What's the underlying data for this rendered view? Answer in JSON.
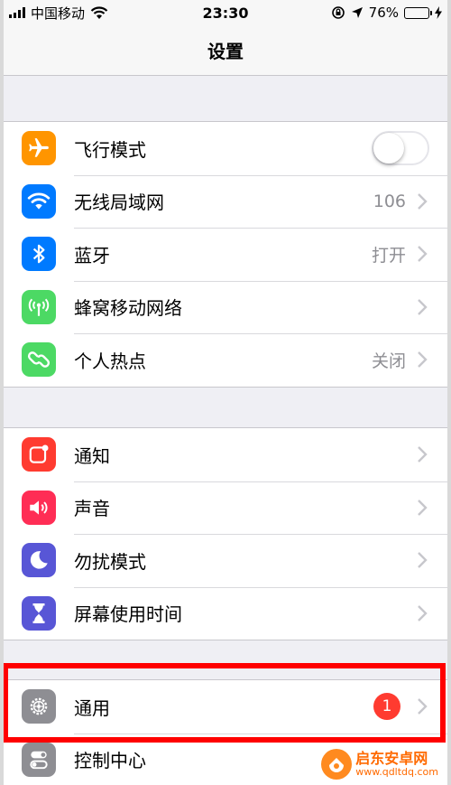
{
  "status_bar": {
    "carrier": "中国移动",
    "time": "23:30",
    "battery_percent": "76%",
    "battery_level": 0.76,
    "icons": [
      "signal-icon",
      "wifi-icon",
      "orientation-lock-icon",
      "location-icon",
      "battery-icon",
      "charging-icon"
    ]
  },
  "nav": {
    "title": "设置"
  },
  "groups": [
    {
      "rows": [
        {
          "label": "飞行模式",
          "icon": "airplane-icon",
          "icon_color": "#ff9500",
          "accessory": "toggle",
          "toggle_on": false
        },
        {
          "label": "无线局域网",
          "icon": "wifi-icon",
          "icon_color": "#007aff",
          "value": "106"
        },
        {
          "label": "蓝牙",
          "icon": "bluetooth-icon",
          "icon_color": "#007aff",
          "value": "打开"
        },
        {
          "label": "蜂窝移动网络",
          "icon": "cellular-icon",
          "icon_color": "#4cd964",
          "value": ""
        },
        {
          "label": "个人热点",
          "icon": "hotspot-icon",
          "icon_color": "#4cd964",
          "value": "关闭"
        }
      ]
    },
    {
      "rows": [
        {
          "label": "通知",
          "icon": "notifications-icon",
          "icon_color": "#ff3b30"
        },
        {
          "label": "声音",
          "icon": "sound-icon",
          "icon_color": "#ff2d55"
        },
        {
          "label": "勿扰模式",
          "icon": "moon-icon",
          "icon_color": "#5856d6"
        },
        {
          "label": "屏幕使用时间",
          "icon": "hourglass-icon",
          "icon_color": "#5856d6"
        }
      ]
    },
    {
      "rows": [
        {
          "label": "通用",
          "icon": "gear-icon",
          "icon_color": "#8e8e93",
          "badge": "1",
          "highlighted": true
        },
        {
          "label": "控制中心",
          "icon": "control-center-icon",
          "icon_color": "#8e8e93"
        }
      ]
    }
  ],
  "highlight_color": "#ff0000",
  "watermark": {
    "title": "启东安卓网",
    "url": "www.qdltdq.com"
  }
}
